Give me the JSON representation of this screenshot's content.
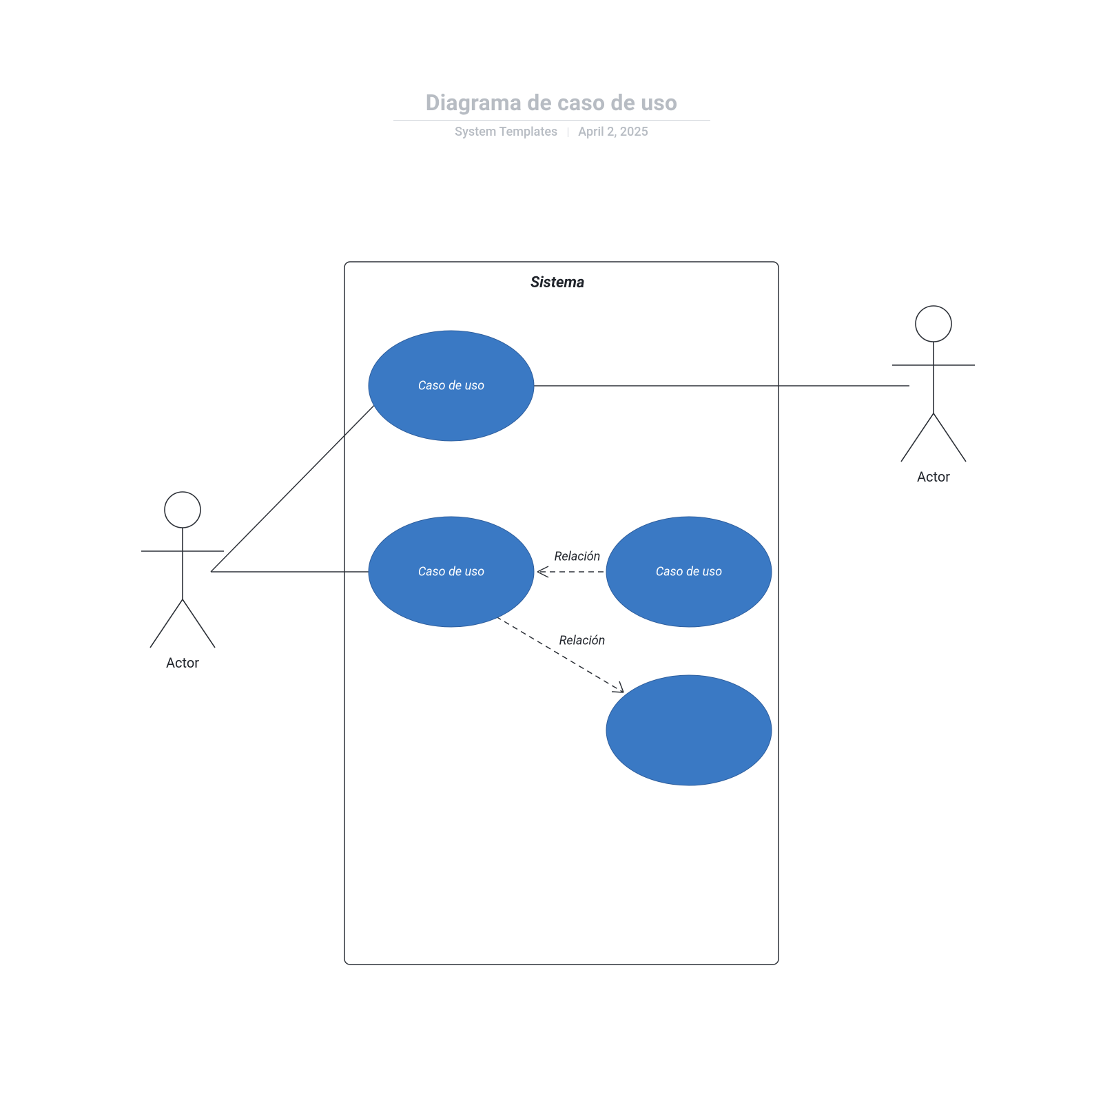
{
  "header": {
    "title": "Diagrama de caso de uso",
    "author": "System Templates",
    "date": "April 2, 2025"
  },
  "system": {
    "label": "Sistema"
  },
  "usecases": {
    "uc1": "Caso de uso",
    "uc2": "Caso de uso",
    "uc3": "Caso de uso",
    "uc4": ""
  },
  "relations": {
    "r1": "Relación",
    "r2": "Relación"
  },
  "actors": {
    "left": "Actor",
    "right": "Actor"
  },
  "colors": {
    "usecase_fill": "#3a79c4",
    "stroke": "#2d3138",
    "dash": "#2d3138"
  }
}
